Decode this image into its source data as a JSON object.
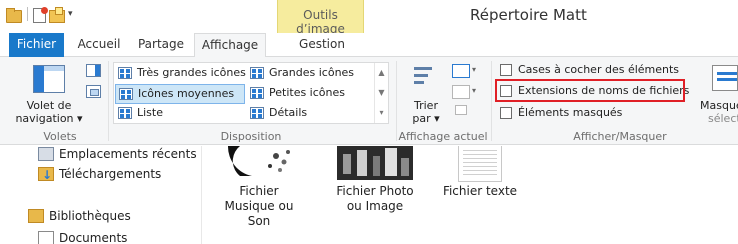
{
  "window": {
    "title": "Répertoire Matt",
    "contextual_tab_group": "Outils d’image"
  },
  "tabs": {
    "file": "Fichier",
    "home": "Accueil",
    "share": "Partage",
    "view": "Affichage",
    "manage": "Gestion"
  },
  "ribbon": {
    "panes": {
      "nav_pane_label_line1": "Volet de",
      "nav_pane_label_line2": "navigation ▾",
      "group_label": "Volets"
    },
    "layout": {
      "items": [
        "Très grandes icônes",
        "Icônes moyennes",
        "Liste",
        "Grandes icônes",
        "Petites icônes",
        "Détails"
      ],
      "selected": "Icônes moyennes",
      "group_label": "Disposition"
    },
    "current_view": {
      "sort_label_line1": "Trier",
      "sort_label_line2": "par ▾",
      "group_label": "Affichage actuel"
    },
    "show_hide": {
      "checkboxes": [
        "Cases à cocher des éléments",
        "Extensions de noms de fichiers",
        "Éléments masqués"
      ],
      "highlighted": "Extensions de noms de fichiers",
      "hide_selected_line1": "Masquer le",
      "hide_selected_line2": "sélecti",
      "group_label": "Afficher/Masquer"
    }
  },
  "navigation_tree": [
    "Emplacements récents",
    "Téléchargements",
    "Bibliothèques",
    "Documents"
  ],
  "files": [
    {
      "name_line1": "Fichier",
      "name_line2": "Musique ou",
      "name_line3": "Son"
    },
    {
      "name_line1": "Fichier Photo",
      "name_line2": "ou Image",
      "name_line3": ""
    },
    {
      "name_line1": "Fichier texte",
      "name_line2": "",
      "name_line3": ""
    }
  ],
  "colors": {
    "file_tab": "#1979ca",
    "contextual_tab": "#f6ec9e",
    "highlight_border": "#e01f26",
    "selected_item": "#cde6f7"
  }
}
